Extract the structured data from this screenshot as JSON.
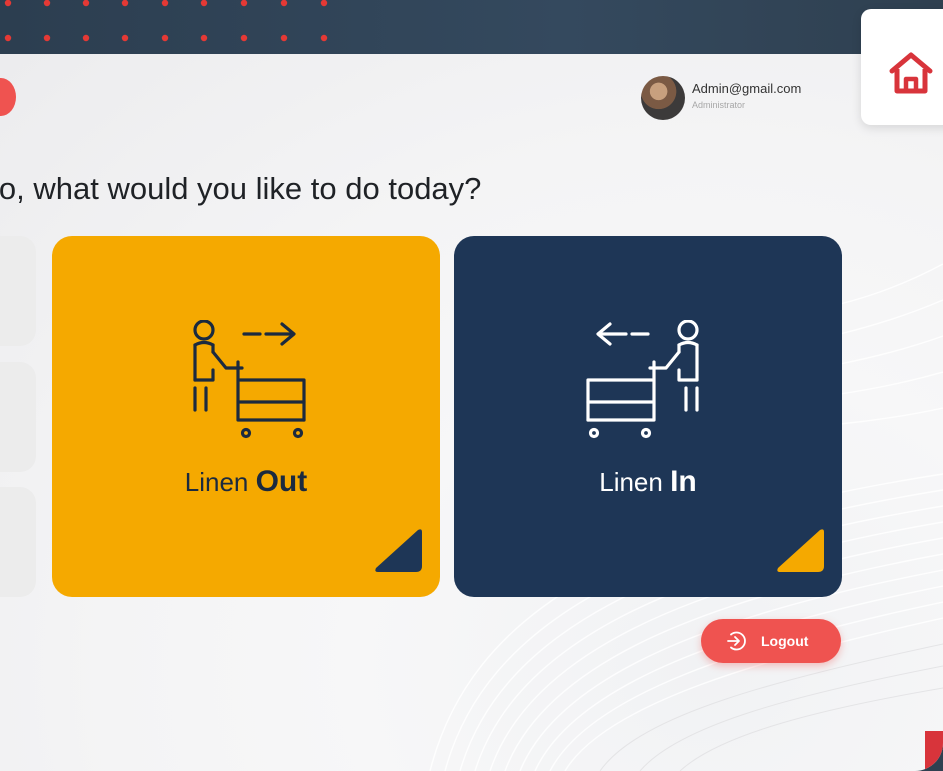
{
  "header": {
    "home_icon": "home-icon"
  },
  "user": {
    "email": "Admin@gmail.com",
    "role": "Administrator"
  },
  "greeting": "lo, what would you like to do today?",
  "cards": [
    {
      "label_prefix": "Linen ",
      "label_strong": "Out",
      "icon": "linen-out-icon",
      "color": "#f5a900",
      "corner_color": "#1e3656"
    },
    {
      "label_prefix": "Linen ",
      "label_strong": "In",
      "icon": "linen-in-icon",
      "color": "#1e3656",
      "corner_color": "#f5a900"
    }
  ],
  "logout": {
    "label": "Logout",
    "icon": "logout-icon",
    "color": "#ef5350"
  },
  "colors": {
    "accent_red": "#ef5350",
    "topbar": "#2c3e50",
    "dot_red": "#e53935"
  }
}
